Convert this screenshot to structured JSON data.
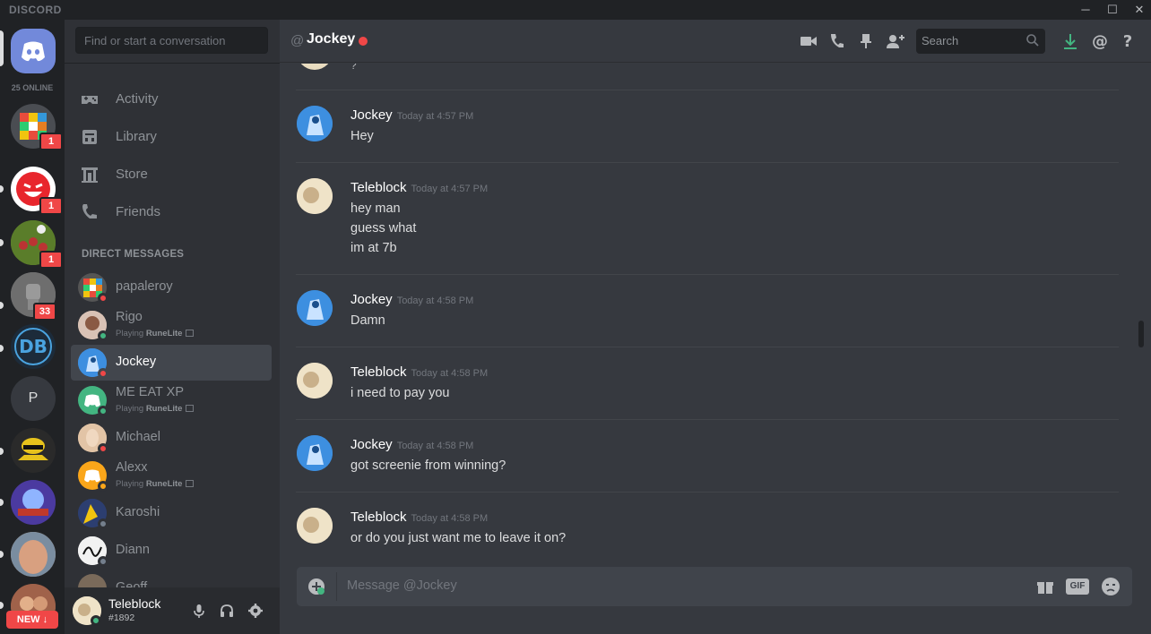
{
  "window": {
    "app_name": "DISCORD",
    "minimize_glyph": "─",
    "maximize_glyph": "☐",
    "close_glyph": "✕"
  },
  "servers": {
    "online_count": "25 ONLINE",
    "badges": [
      "1",
      "1",
      "1",
      "33"
    ],
    "letter_server": "P",
    "new_button": "NEW ↓"
  },
  "dm_column": {
    "search_placeholder": "Find or start a conversation",
    "nav": [
      {
        "label": "Activity",
        "icon": "controller-icon"
      },
      {
        "label": "Library",
        "icon": "library-icon"
      },
      {
        "label": "Store",
        "icon": "store-icon"
      },
      {
        "label": "Friends",
        "icon": "friends-icon"
      }
    ],
    "direct_messages_header": "DIRECT MESSAGES",
    "dms": [
      {
        "name": "papaleroy",
        "status": "dnd",
        "activity": ""
      },
      {
        "name": "Rigo",
        "status": "online",
        "activity_prefix": "Playing ",
        "activity_game": "RuneLite"
      },
      {
        "name": "Jockey",
        "status": "dnd",
        "activity": "",
        "selected": true
      },
      {
        "name": "ME EAT XP",
        "status": "online",
        "activity_prefix": "Playing ",
        "activity_game": "RuneLite"
      },
      {
        "name": "Michael",
        "status": "dnd",
        "activity": ""
      },
      {
        "name": "Alexx",
        "status": "idle",
        "activity_prefix": "Playing ",
        "activity_game": "RuneLite"
      },
      {
        "name": "Karoshi",
        "status": "offline",
        "activity": ""
      },
      {
        "name": "Diann",
        "status": "offline",
        "activity": ""
      },
      {
        "name": "Geoff",
        "status": "offline",
        "activity": ""
      }
    ],
    "user_panel": {
      "name": "Teleblock",
      "tag": "#1892"
    }
  },
  "chat": {
    "at_symbol": "@",
    "title": "Jockey",
    "search_placeholder": "Search",
    "partial_top_line": "?",
    "messages": [
      {
        "author": "Jockey",
        "time": "Today at 4:57 PM",
        "lines": [
          "Hey"
        ]
      },
      {
        "author": "Teleblock",
        "time": "Today at 4:57 PM",
        "lines": [
          "hey man",
          "guess what",
          "im at 7b"
        ]
      },
      {
        "author": "Jockey",
        "time": "Today at 4:58 PM",
        "lines": [
          "Damn"
        ]
      },
      {
        "author": "Teleblock",
        "time": "Today at 4:58 PM",
        "lines": [
          "i need to pay you"
        ]
      },
      {
        "author": "Jockey",
        "time": "Today at 4:58 PM",
        "lines": [
          "got screenie from winning?"
        ]
      },
      {
        "author": "Teleblock",
        "time": "Today at 4:58 PM",
        "lines": [
          "or do you just want me to leave it on?"
        ]
      }
    ],
    "composer_placeholder": "Message @Jockey",
    "gif_label": "GIF"
  },
  "colors": {
    "dnd": "#f04747",
    "online": "#43b581",
    "idle": "#faa61a",
    "offline": "#747f8d",
    "blurple": "#7289da"
  }
}
